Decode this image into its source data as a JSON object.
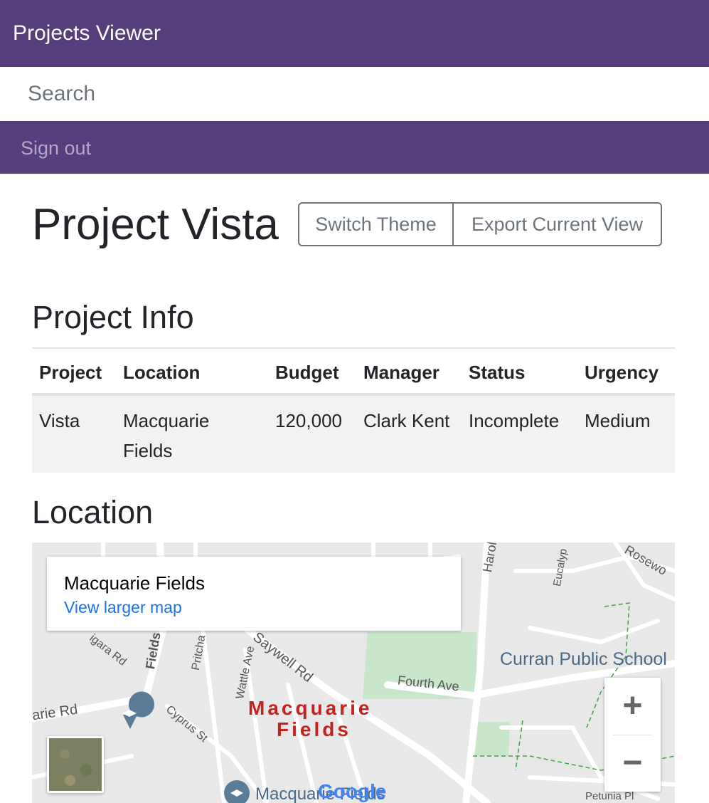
{
  "header": {
    "brand": "Projects Viewer",
    "sign_out": "Sign out"
  },
  "search": {
    "placeholder": "Search",
    "value": ""
  },
  "page": {
    "title": "Project Vista",
    "buttons": {
      "switch_theme": "Switch Theme",
      "export_view": "Export Current View"
    }
  },
  "project_info": {
    "heading": "Project Info",
    "columns": [
      "Project",
      "Location",
      "Budget",
      "Manager",
      "Status",
      "Urgency"
    ],
    "rows": [
      [
        "Vista",
        "Macquarie Fields",
        "120,000",
        "Clark Kent",
        "Incomplete",
        "Medium"
      ]
    ]
  },
  "location": {
    "heading": "Location",
    "map": {
      "place_title": "Macquarie Fields",
      "larger_map_link": "View larger map",
      "zoom_in": "+",
      "zoom_out": "−",
      "labels": {
        "suburb_line1": "Macquarie",
        "suburb_line2": "Fields",
        "school": "Curran Public School",
        "harold": "Harold St",
        "eucalyp": "Eucalyp",
        "rosewood": "Rosewo",
        "fourth_ave": "Fourth Ave",
        "saywell": "Saywell Rd",
        "wattle": "Wattle Ave",
        "pritchard": "Pritcha",
        "cyprus": "Cyprus St",
        "fields": "Fields",
        "ngara": "igara Rd",
        "arie_rd": "arie Rd",
        "petunia": "Petunia Pl",
        "macquarie_fields_bottom": "Macquarie Fields",
        "google": "Google"
      },
      "colors": {
        "suburb_label": "#c5221f",
        "park": "#c8e6c9",
        "road": "#ffffff",
        "background": "#e8e8e8"
      }
    }
  }
}
